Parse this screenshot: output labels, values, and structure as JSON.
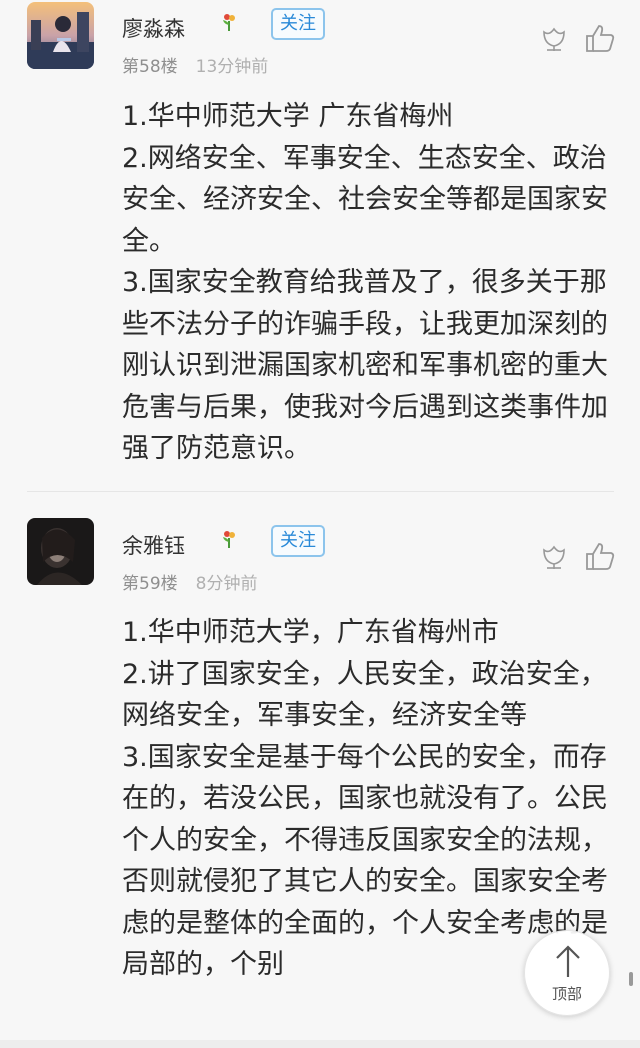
{
  "posts": [
    {
      "author": "廖淼森",
      "follow_label": "关注",
      "floor": "第58楼",
      "time": "13分钟前",
      "lines": [
        "1.华中师范大学 广东省梅州",
        "2.网络安全、军事安全、生态安全、政治安全、经济安全、社会安全等都是国家安全。",
        "3.国家安全教育给我普及了，很多关于那些不法分子的诈骗手段，让我更加深刻的刚认识到泄漏国家机密和军事机密的重大危害与后果，使我对今后遇到这类事件加强了防范意识。"
      ]
    },
    {
      "author": "余雅钰",
      "follow_label": "关注",
      "floor": "第59楼",
      "time": "8分钟前",
      "lines": [
        "1.华中师范大学，广东省梅州市",
        "2.讲了国家安全，人民安全，政治安全，网络安全，军事安全，经济安全等",
        "3.国家安全是基于每个公民的安全，而存在的，若没公民，国家也就没有了。公民个人的安全，不得违反国家安全的法规，否则就侵犯了其它人的安全。国家安全考虑的是整体的全面的，个人安全考虑的是局部的，个别"
      ]
    }
  ],
  "back_to_top_label": "顶部",
  "colors": {
    "accent": "#2a8ad8",
    "follow_border": "#8cc4ec",
    "meta": "#9a9a9a"
  }
}
